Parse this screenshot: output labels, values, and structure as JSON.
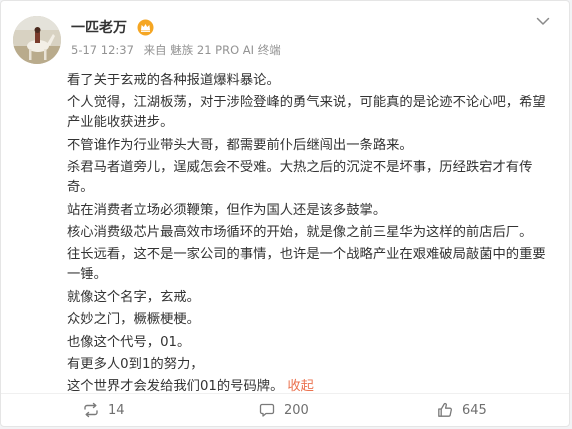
{
  "post": {
    "author": "一匹老万",
    "date": "5-17 12:37",
    "source": "来自 魅族 21 PRO AI 终端",
    "paragraphs": [
      "看了关于玄戒的各种报道爆料暴论。",
      "个人觉得，江湖板荡，对于涉险登峰的勇气来说，可能真的是论迹不论心吧，希望产业能收获进步。",
      "不管谁作为行业带头大哥，都需要前仆后继闯出一条路来。",
      "杀君马者道旁儿，逞威怎会不受难。大热之后的沉淀不是坏事，历经跌宕才有传奇。",
      "站在消费者立场必须鞭策，但作为国人还是该多鼓掌。",
      "核心消费级芯片最高效市场循环的开始，就是像之前三星华为这样的前店后厂。",
      "往长远看，这不是一家公司的事情，也许是一个战略产业在艰难破局敲菌中的重要一锤。",
      "就像这个名字，玄戒。",
      "众妙之门，橛橛梗梗。",
      "也像这个代号，01。",
      "有更多人0到1的努力，"
    ],
    "last_line": "这个世界才会发给我们01的号码牌。",
    "collapse_label": "收起"
  },
  "actions": {
    "repost_count": "14",
    "comment_count": "200",
    "like_count": "645"
  },
  "colors": {
    "link": "#eb7350",
    "badge": "#f5a623",
    "text": "#333333",
    "meta": "#939393"
  },
  "icons": {
    "more": "chevron-down-icon",
    "badge": "vip-crown-icon",
    "repost": "repost-icon",
    "comment": "comment-icon",
    "like": "thumbs-up-icon"
  }
}
